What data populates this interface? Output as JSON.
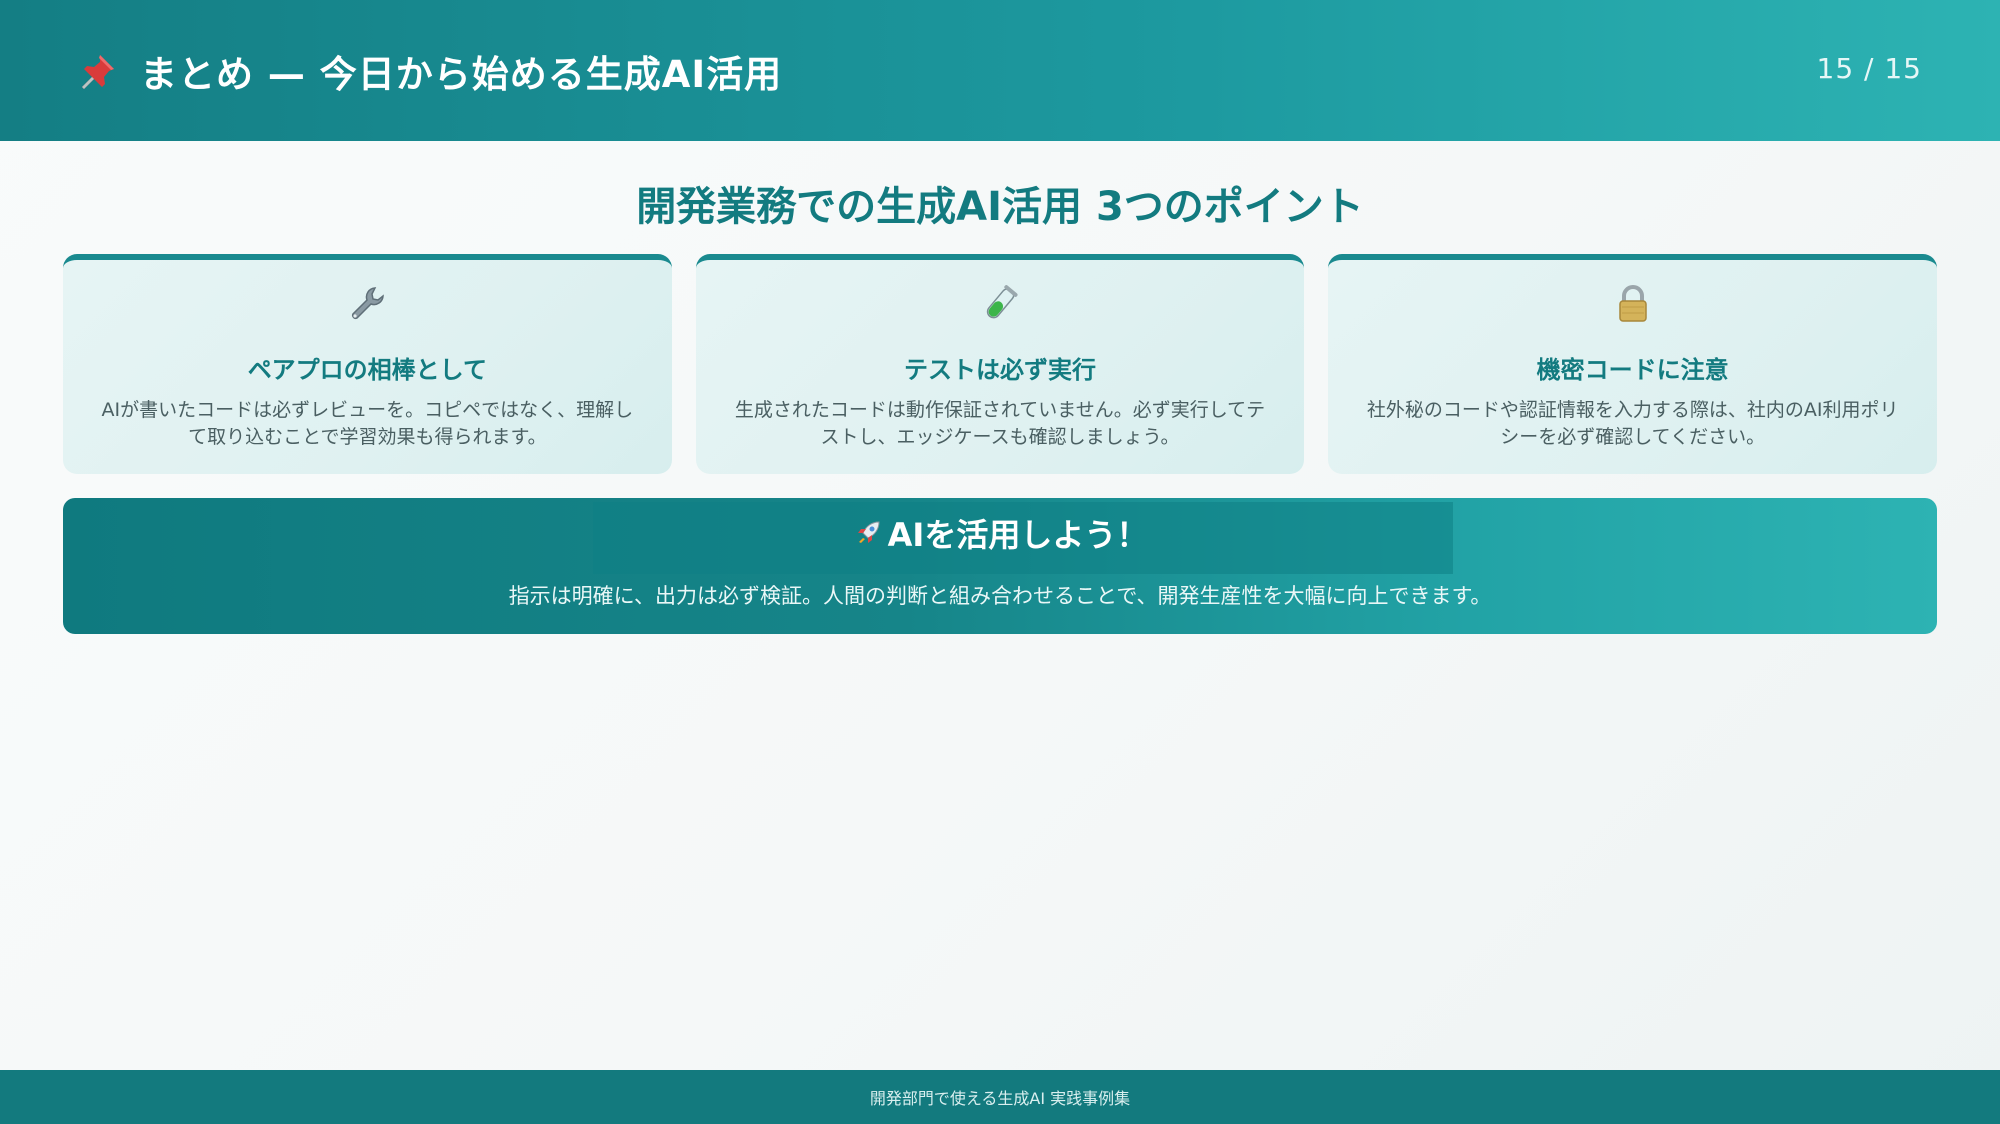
{
  "header": {
    "icon": "pushpin-icon",
    "title": "まとめ — 今日から始める生成AI活用",
    "page_number": "15 / 15"
  },
  "section": {
    "title": "開発業務での生成AI活用 3つのポイント"
  },
  "cards": [
    {
      "icon": "wrench-icon",
      "title": "ペアプロの相棒として",
      "desc": "AIが書いたコードは必ずレビューを。コピペではなく、理解して取り込むことで学習効果も得られます。"
    },
    {
      "icon": "test-tube-icon",
      "title": "テストは必ず実行",
      "desc": "生成されたコードは動作保証されていません。必ず実行してテストし、エッジケースも確認しましょう。"
    },
    {
      "icon": "lock-icon",
      "title": "機密コードに注意",
      "desc": "社外秘のコードや認証情報を入力する際は、社内のAI利用ポリシーを必ず確認してください。"
    }
  ],
  "banner": {
    "icon": "rocket-icon",
    "title": "AIを活用しよう！",
    "text": "指示は明確に、出力は必ず検証。人間の判断と組み合わせることで、開発生産性を大幅に向上できます。"
  },
  "footer": {
    "text": "開発部門で使える生成AI 実践事例集"
  },
  "colors": {
    "primary": "#137b80",
    "header_start": "#147e84",
    "header_end": "#2db3b3",
    "card_bg": "#e3f3f3",
    "footer_bg": "#137a7e"
  }
}
